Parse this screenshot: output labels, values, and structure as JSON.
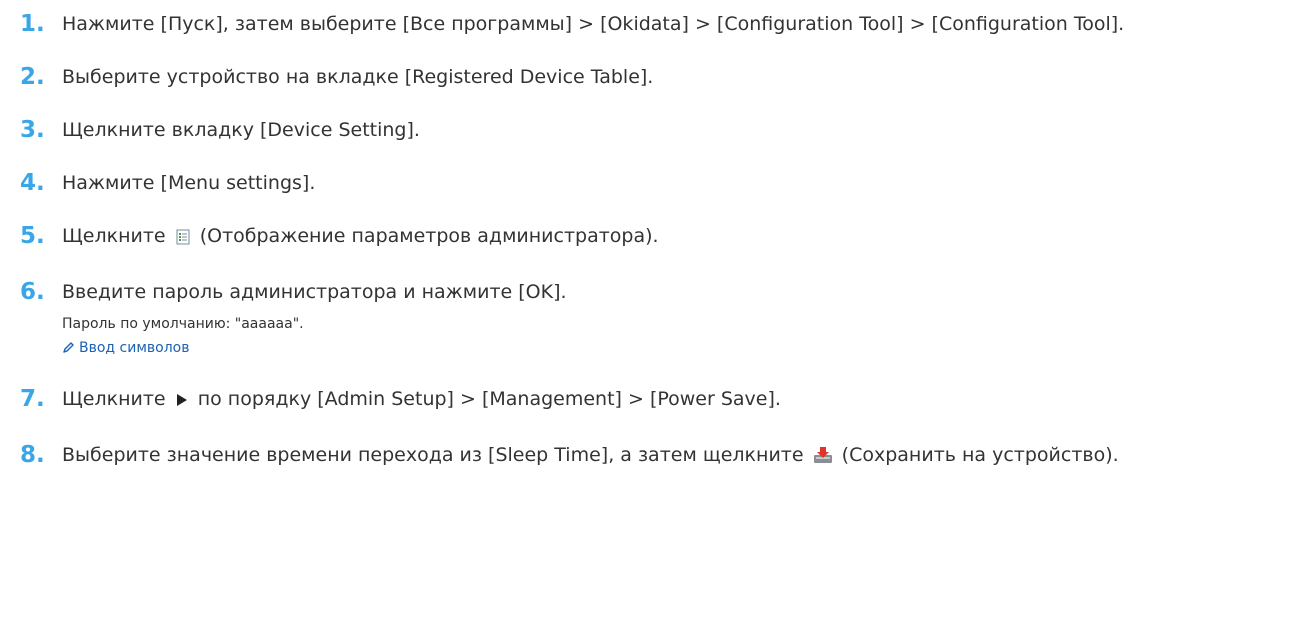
{
  "steps": [
    {
      "num": "1",
      "parts": [
        "Нажмите [Пуск], затем выберите [Все программы] > [Okidata] > [Configuration Tool] > [Configuration Tool]."
      ]
    },
    {
      "num": "2",
      "parts": [
        "Выберите устройство на вкладке [Registered Device Table]."
      ]
    },
    {
      "num": "3",
      "parts": [
        "Щелкните вкладку [Device Setting]."
      ]
    },
    {
      "num": "4",
      "parts": [
        "Нажмите [Menu settings]."
      ]
    },
    {
      "num": "5",
      "parts": [
        "Щелкните",
        "(Отображение параметров администратора)."
      ],
      "icon": "admin-settings-icon"
    },
    {
      "num": "6",
      "parts": [
        "Введите пароль администратора и нажмите [OK]."
      ],
      "note": "Пароль по умолчанию: \"aaaaaa\".",
      "link": "Ввод символов"
    },
    {
      "num": "7",
      "parts": [
        "Щелкните",
        "по порядку [Admin Setup] > [Management] > [Power Save]."
      ],
      "icon": "triangle-right-icon"
    },
    {
      "num": "8",
      "parts": [
        "Выберите значение времени перехода из [Sleep Time], а затем щелкните",
        "(Сохранить на устройство)."
      ],
      "icon": "save-to-device-icon"
    }
  ],
  "colors": {
    "step_number": "#3aa6e8",
    "text": "#333333",
    "link": "#1a62b6"
  }
}
